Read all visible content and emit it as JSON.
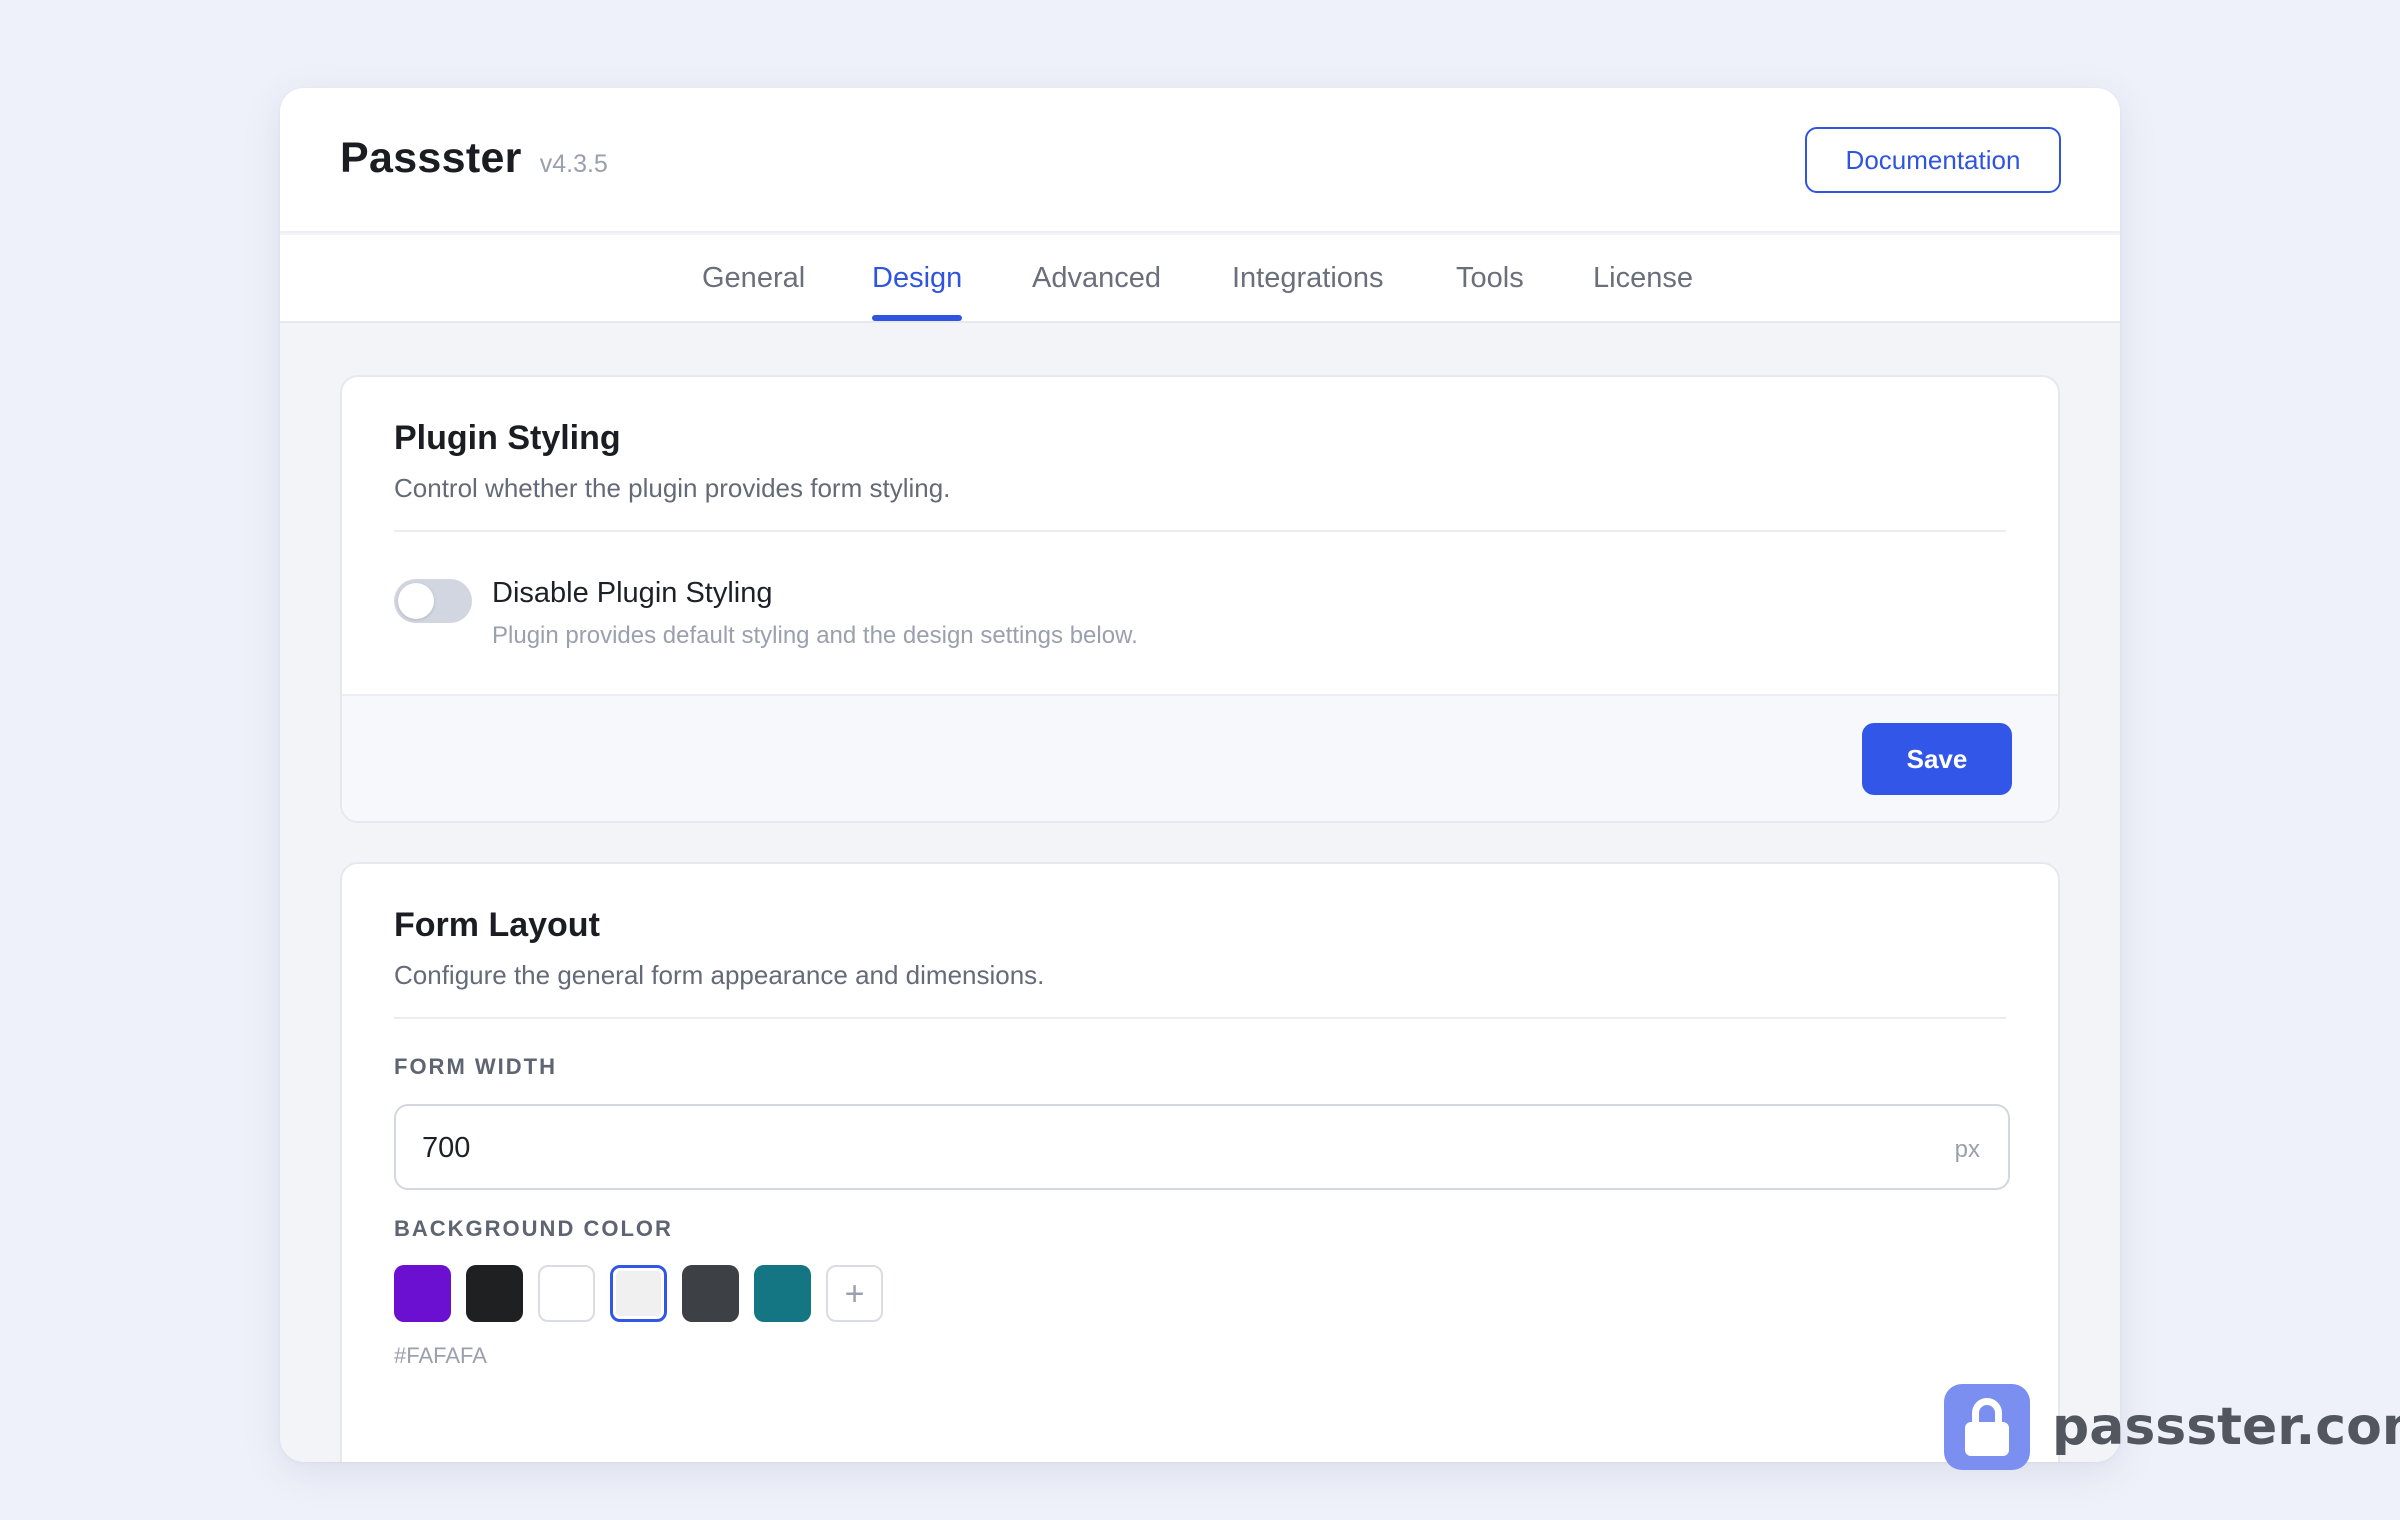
{
  "header": {
    "app_name": "Passster",
    "version": "v4.3.5",
    "documentation_label": "Documentation"
  },
  "tabs": [
    {
      "label": "General",
      "active": false
    },
    {
      "label": "Design",
      "active": true
    },
    {
      "label": "Advanced",
      "active": false
    },
    {
      "label": "Integrations",
      "active": false
    },
    {
      "label": "Tools",
      "active": false
    },
    {
      "label": "License",
      "active": false
    }
  ],
  "plugin_styling": {
    "title": "Plugin Styling",
    "description": "Control whether the plugin provides form styling.",
    "toggle_label": "Disable Plugin Styling",
    "toggle_help": "Plugin provides default styling and the design settings below.",
    "toggle_on": false,
    "save_label": "Save"
  },
  "form_layout": {
    "title": "Form Layout",
    "description": "Configure the general form appearance and dimensions.",
    "form_width_label": "FORM WIDTH",
    "form_width_value": "700",
    "form_width_unit": "px",
    "background_color_label": "BACKGROUND COLOR",
    "swatches": [
      {
        "color": "#6b0fd1",
        "name": "purple"
      },
      {
        "color": "#1f2022",
        "name": "black"
      },
      {
        "color": "#ffffff",
        "name": "white"
      },
      {
        "color": "#f0f0f1",
        "name": "light-gray",
        "selected": true
      },
      {
        "color": "#3d4045",
        "name": "dark-gray"
      },
      {
        "color": "#137682",
        "name": "teal"
      }
    ],
    "add_symbol": "+",
    "selected_hex": "#FAFAFA"
  },
  "watermark": {
    "text": "passster.com",
    "icon": "lock-icon"
  },
  "colors": {
    "accent": "#2f55e0",
    "save_button": "#3257e8"
  }
}
